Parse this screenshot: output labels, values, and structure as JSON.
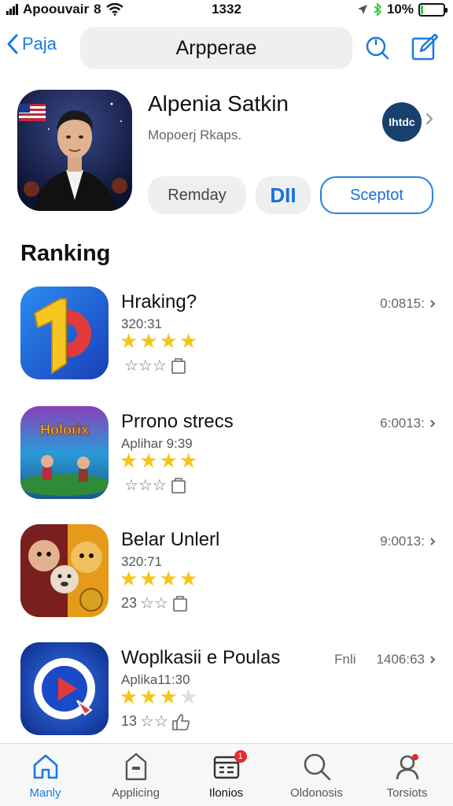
{
  "status_bar": {
    "carrier": "Apoouvair",
    "carrier_suffix": "8",
    "time": "1332",
    "battery": "10%",
    "battery_level": 0.1
  },
  "nav": {
    "back_label": "Paja",
    "search_text": "Arpperae"
  },
  "app": {
    "title": "Alpenia Satkin",
    "subtitle": "Mopoerj Rkaps.",
    "developer_badge": "Ihtdc",
    "buttons": {
      "primary": "Remday",
      "middle": "DII",
      "outline": "Sceptot"
    }
  },
  "ranking": {
    "title": "Ranking",
    "items": [
      {
        "name": "Hraking?",
        "meta": "320:31",
        "rating": 4,
        "bottom_text": "",
        "value": "0:0815:",
        "icon": "gold-1-icon"
      },
      {
        "name": "Prrono strecs",
        "meta": "Aplihar 9:39",
        "rating": 4,
        "bottom_text": "",
        "value": "6:0013:",
        "icon": "adventure-game-icon"
      },
      {
        "name": "Belar Unlerl",
        "meta": "320:71",
        "rating": 4,
        "bottom_text": "23",
        "value": "9:0013:",
        "icon": "cartoon-characters-icon"
      },
      {
        "name": "Woplkasii e Poulas",
        "meta": "Aplika11:30",
        "rating": 3,
        "bottom_text": "13",
        "value": "1406:63",
        "prefix": "Fnli",
        "icon": "video-play-icon"
      }
    ]
  },
  "tabbar": {
    "tabs": [
      {
        "label": "Manly",
        "icon": "home-icon"
      },
      {
        "label": "Applicing",
        "icon": "bag-icon"
      },
      {
        "label": "Ilonios",
        "icon": "ticket-icon",
        "badge": "1"
      },
      {
        "label": "Oldonosis",
        "icon": "search-icon"
      },
      {
        "label": "Torsiots",
        "icon": "profile-icon"
      }
    ]
  },
  "colors": {
    "accent": "#1a7ae0",
    "star": "#f5c518",
    "badge": "#e32b2b",
    "battery": "#2dc93e"
  }
}
